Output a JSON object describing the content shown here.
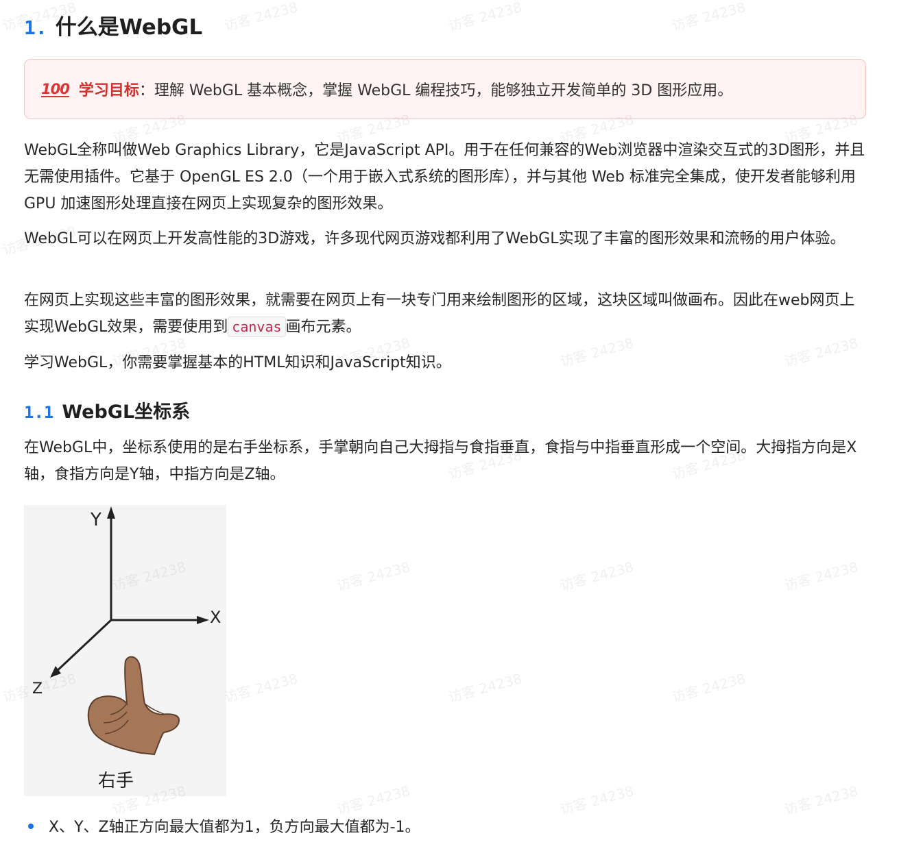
{
  "heading1": {
    "number": "1.",
    "title": "什么是WebGL"
  },
  "goal": {
    "icon_name": "hundred-points-icon",
    "icon_text": "100",
    "label": "学习目标",
    "text": "：理解 WebGL 基本概念，掌握 WebGL 编程技巧，能够独立开发简单的 3D 图形应用。"
  },
  "paragraphs": [
    "WebGL全称叫做Web Graphics Library，它是JavaScript API。用于在任何兼容的Web浏览器中渲染交互式的3D图形，并且无需使用插件。它基于 OpenGL ES 2.0（一个用于嵌入式系统的图形库），并与其他 Web 标准完全集成，使开发者能够利用 GPU 加速图形处理直接在网页上实现复杂的图形效果。",
    "WebGL可以在网页上开发高性能的3D游戏，许多现代网页游戏都利用了WebGL实现了丰富的图形效果和流畅的用户体验。"
  ],
  "paragraph3": {
    "before": "在网页上实现这些丰富的图形效果，就需要在网页上有一块专门用来绘制图形的区域，这块区域叫做画布。因此在web网页上实现WebGL效果，需要使用到",
    "code": "canvas",
    "after": "画布元素。"
  },
  "paragraph4": "学习WebGL，你需要掌握基本的HTML知识和JavaScript知识。",
  "heading2": {
    "number": "1.1",
    "title": "WebGL坐标系"
  },
  "paragraph5": "在WebGL中，坐标系使用的是右手坐标系，手掌朝向自己大拇指与食指垂直，食指与中指垂直形成一个空间。大拇指方向是X轴，食指方向是Y轴，中指方向是Z轴。",
  "figure": {
    "y_label": "Y",
    "x_label": "X",
    "z_label": "Z",
    "caption": "右手"
  },
  "bullets": [
    "X、Y、Z轴正方向最大值都为1，负方向最大值都为-1。"
  ],
  "watermark": "访客 24238"
}
